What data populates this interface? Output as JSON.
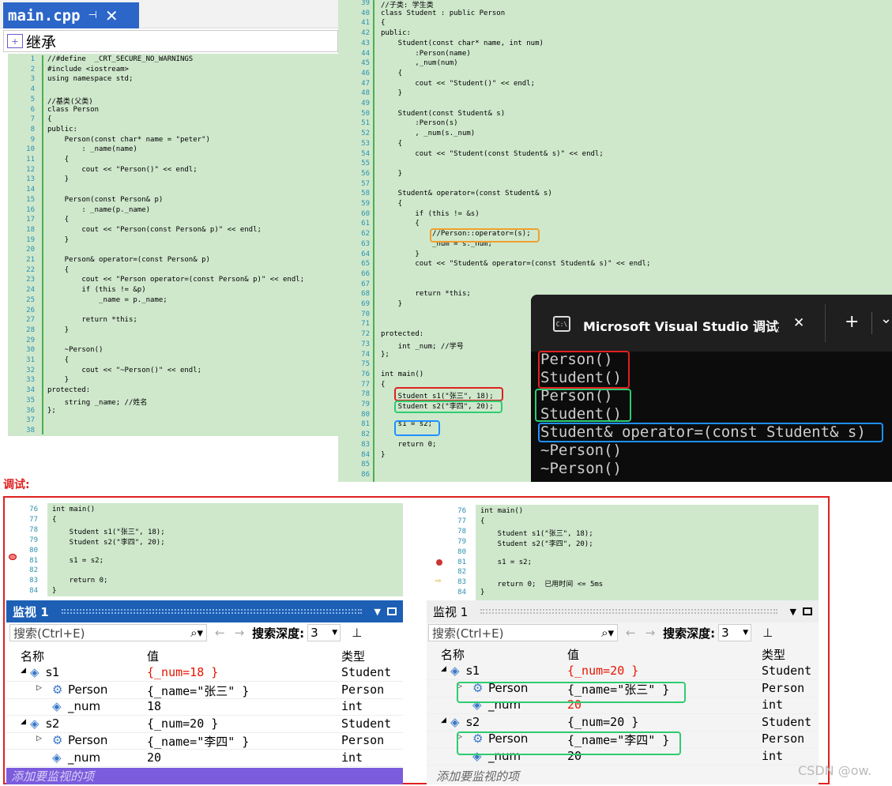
{
  "tab": {
    "title": "main.cpp",
    "pin": "⊣",
    "close": "✕"
  },
  "scope": {
    "label": "继承"
  },
  "left_code": {
    "lines": [
      {
        "n": "1",
        "t": "//#define  _CRT_SECURE_NO_WARNINGS"
      },
      {
        "n": "2",
        "t": "#include <iostream>"
      },
      {
        "n": "3",
        "t": "using namespace std;"
      },
      {
        "n": "4",
        "t": ""
      },
      {
        "n": "5",
        "t": "//基类(父类)"
      },
      {
        "n": "6",
        "t": "class Person"
      },
      {
        "n": "7",
        "t": "{"
      },
      {
        "n": "8",
        "t": "public:"
      },
      {
        "n": "9",
        "t": "    Person(const char* name = \"peter\")"
      },
      {
        "n": "10",
        "t": "        : _name(name)"
      },
      {
        "n": "11",
        "t": "    {"
      },
      {
        "n": "12",
        "t": "        cout << \"Person()\" << endl;"
      },
      {
        "n": "13",
        "t": "    }"
      },
      {
        "n": "14",
        "t": ""
      },
      {
        "n": "15",
        "t": "    Person(const Person& p)"
      },
      {
        "n": "16",
        "t": "        : _name(p._name)"
      },
      {
        "n": "17",
        "t": "    {"
      },
      {
        "n": "18",
        "t": "        cout << \"Person(const Person& p)\" << endl;"
      },
      {
        "n": "19",
        "t": "    }"
      },
      {
        "n": "20",
        "t": ""
      },
      {
        "n": "21",
        "t": "    Person& operator=(const Person& p)"
      },
      {
        "n": "22",
        "t": "    {"
      },
      {
        "n": "23",
        "t": "        cout << \"Person operator=(const Person& p)\" << endl;"
      },
      {
        "n": "24",
        "t": "        if (this != &p)"
      },
      {
        "n": "25",
        "t": "            _name = p._name;"
      },
      {
        "n": "26",
        "t": ""
      },
      {
        "n": "27",
        "t": "        return *this;"
      },
      {
        "n": "28",
        "t": "    }"
      },
      {
        "n": "29",
        "t": ""
      },
      {
        "n": "30",
        "t": "    ~Person()"
      },
      {
        "n": "31",
        "t": "    {"
      },
      {
        "n": "32",
        "t": "        cout << \"~Person()\" << endl;"
      },
      {
        "n": "33",
        "t": "    }"
      },
      {
        "n": "34",
        "t": "protected:"
      },
      {
        "n": "35",
        "t": "    string _name; //姓名"
      },
      {
        "n": "36",
        "t": "};"
      },
      {
        "n": "37",
        "t": ""
      },
      {
        "n": "38",
        "t": ""
      }
    ]
  },
  "right_code": {
    "lines": [
      {
        "n": "39",
        "t": "//子类: 学生类"
      },
      {
        "n": "40",
        "t": "class Student : public Person"
      },
      {
        "n": "41",
        "t": "{"
      },
      {
        "n": "42",
        "t": "public:"
      },
      {
        "n": "43",
        "t": "    Student(const char* name, int num)"
      },
      {
        "n": "44",
        "t": "        :Person(name)"
      },
      {
        "n": "45",
        "t": "        ,_num(num)"
      },
      {
        "n": "46",
        "t": "    {"
      },
      {
        "n": "47",
        "t": "        cout << \"Student()\" << endl;"
      },
      {
        "n": "48",
        "t": "    }"
      },
      {
        "n": "49",
        "t": ""
      },
      {
        "n": "50",
        "t": "    Student(const Student& s)"
      },
      {
        "n": "51",
        "t": "        :Person(s)"
      },
      {
        "n": "52",
        "t": "        , _num(s._num)"
      },
      {
        "n": "53",
        "t": "    {"
      },
      {
        "n": "54",
        "t": "        cout << \"Student(const Student& s)\" << endl;"
      },
      {
        "n": "55",
        "t": ""
      },
      {
        "n": "56",
        "t": "    }"
      },
      {
        "n": "57",
        "t": ""
      },
      {
        "n": "58",
        "t": "    Student& operator=(const Student& s)"
      },
      {
        "n": "59",
        "t": "    {"
      },
      {
        "n": "60",
        "t": "        if (this != &s)"
      },
      {
        "n": "61",
        "t": "        {"
      },
      {
        "n": "62",
        "t": "            //Person::operator=(s);"
      },
      {
        "n": "63",
        "t": "            _num = s._num;"
      },
      {
        "n": "64",
        "t": "        }"
      },
      {
        "n": "65",
        "t": "        cout << \"Student& operator=(const Student& s)\" << endl;"
      },
      {
        "n": "66",
        "t": ""
      },
      {
        "n": "67",
        "t": ""
      },
      {
        "n": "68",
        "t": "        return *this;"
      },
      {
        "n": "69",
        "t": "    }"
      },
      {
        "n": "70",
        "t": ""
      },
      {
        "n": "71",
        "t": ""
      },
      {
        "n": "72",
        "t": "protected:"
      },
      {
        "n": "73",
        "t": "    int _num; //学号"
      },
      {
        "n": "74",
        "t": "};"
      },
      {
        "n": "75",
        "t": ""
      },
      {
        "n": "76",
        "t": "int main()"
      },
      {
        "n": "77",
        "t": "{"
      },
      {
        "n": "78",
        "t": "    Student s1(\"张三\", 18);"
      },
      {
        "n": "79",
        "t": "    Student s2(\"李四\", 20);"
      },
      {
        "n": "80",
        "t": ""
      },
      {
        "n": "81",
        "t": "    s1 = s2;"
      },
      {
        "n": "82",
        "t": ""
      },
      {
        "n": "83",
        "t": "    return 0;"
      },
      {
        "n": "84",
        "t": "}"
      },
      {
        "n": "85",
        "t": ""
      },
      {
        "n": "86",
        "t": ""
      }
    ]
  },
  "console": {
    "title": "Microsoft Visual Studio 调试控",
    "close": "✕",
    "plus": "+",
    "chev": "⌄",
    "icon_text": "C:\\",
    "lines": [
      "Person()",
      "Student()",
      "Person()",
      "Student()",
      "Student& operator=(const Student& s)",
      "~Person()",
      "~Person()"
    ]
  },
  "debug_label": "调试:",
  "debug_left": {
    "code": [
      {
        "n": "76",
        "t": "int main()"
      },
      {
        "n": "77",
        "t": "{"
      },
      {
        "n": "78",
        "t": "    Student s1(\"张三\", 18);"
      },
      {
        "n": "79",
        "t": "    Student s2(\"李四\", 20);"
      },
      {
        "n": "80",
        "t": ""
      },
      {
        "n": "81",
        "t": "    s1 = s2;"
      },
      {
        "n": "82",
        "t": ""
      },
      {
        "n": "83",
        "t": "    return 0;"
      },
      {
        "n": "84",
        "t": "}"
      }
    ],
    "watch_title": "监视 1",
    "search_placeholder": "搜索(Ctrl+E)",
    "depth_label": "搜索深度:",
    "depth_value": "3",
    "col_name": "名称",
    "col_value": "值",
    "col_type": "类型",
    "rows": [
      {
        "name": "s1",
        "value": "{_num=18 }",
        "type": "Student"
      },
      {
        "name": "Person",
        "value": "{_name=\"张三\" }",
        "type": "Person"
      },
      {
        "name": "_num",
        "value": "18",
        "type": "int"
      },
      {
        "name": "s2",
        "value": "{_num=20 }",
        "type": "Student"
      },
      {
        "name": "Person",
        "value": "{_name=\"李四\" }",
        "type": "Person"
      },
      {
        "name": "_num",
        "value": "20",
        "type": "int"
      }
    ],
    "add_item": "添加要监视的项"
  },
  "debug_right": {
    "code": [
      {
        "n": "76",
        "t": "int main()"
      },
      {
        "n": "77",
        "t": "{"
      },
      {
        "n": "78",
        "t": "    Student s1(\"张三\", 18);"
      },
      {
        "n": "79",
        "t": "    Student s2(\"李四\", 20);"
      },
      {
        "n": "80",
        "t": ""
      },
      {
        "n": "81",
        "t": "    s1 = s2;"
      },
      {
        "n": "82",
        "t": ""
      },
      {
        "n": "83",
        "t": "    return 0;  已用时间 <= 5ms"
      },
      {
        "n": "84",
        "t": "}"
      }
    ],
    "watch_title": "监视 1",
    "search_placeholder": "搜索(Ctrl+E)",
    "depth_label": "搜索深度:",
    "depth_value": "3",
    "col_name": "名称",
    "col_value": "值",
    "col_type": "类型",
    "rows": [
      {
        "name": "s1",
        "value": "{_num=20 }",
        "type": "Student"
      },
      {
        "name": "Person",
        "value": "{_name=\"张三\" }",
        "type": "Person"
      },
      {
        "name": "_num",
        "value": "20",
        "type": "int"
      },
      {
        "name": "s2",
        "value": "{_num=20 }",
        "type": "Student"
      },
      {
        "name": "Person",
        "value": "{_name=\"李四\" }",
        "type": "Person"
      },
      {
        "name": "_num",
        "value": "20",
        "type": "int"
      }
    ],
    "add_item": "添加要监视的项"
  },
  "watermark": "CSDN @ow.",
  "colors": {
    "code_bg": "#cfe8cc",
    "changed": "#e51400",
    "red_box": "#e02020",
    "green_box": "#2ecc71",
    "blue_box": "#1e90ff",
    "orange_box": "#f0a030"
  }
}
